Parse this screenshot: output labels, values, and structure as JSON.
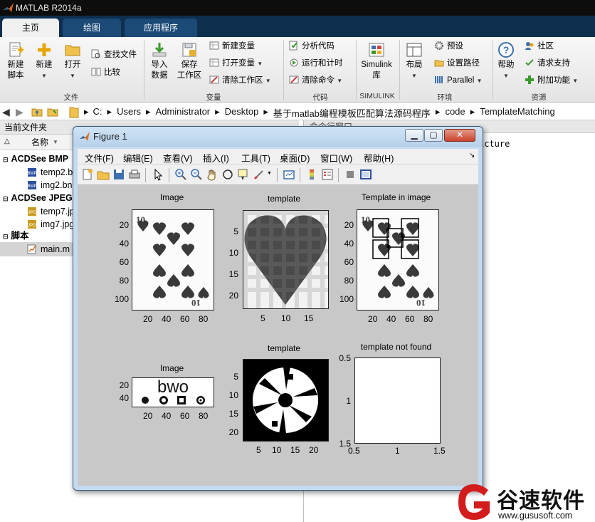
{
  "window": {
    "title": "MATLAB R2014a"
  },
  "tabs": [
    {
      "label": "主页"
    },
    {
      "label": "绘图"
    },
    {
      "label": "应用程序"
    }
  ],
  "ribbon": {
    "new_script": "新建\n脚本",
    "new_script_l1": "新建",
    "new_script_l2": "脚本",
    "new": "新建",
    "open": "打开",
    "find_files": "查找文件",
    "compare": "比较",
    "import_l1": "导入",
    "import_l2": "数据",
    "save_l1": "保存",
    "save_l2": "工作区",
    "new_var": "新建变量",
    "open_var": "打开变量",
    "clear_ws": "清除工作区",
    "analyze": "分析代码",
    "run_time": "运行和计时",
    "clear_cmd": "清除命令",
    "simulink_l1": "Simulink",
    "simulink_l2": "库",
    "layout": "布局",
    "prefs": "预设",
    "set_path": "设置路径",
    "parallel": "Parallel",
    "help": "帮助",
    "community": "社区",
    "support": "请求支持",
    "addons": "附加功能",
    "sections": {
      "file": "文件",
      "variable": "变量",
      "code": "代码",
      "simulink": "SIMULINK",
      "env": "环境",
      "resources": "资源"
    }
  },
  "address": {
    "crumbs": [
      "C:",
      "Users",
      "Administrator",
      "Desktop",
      "基于matlab编程模板匹配算法源码程序",
      "code",
      "TemplateMatching"
    ]
  },
  "current_folder": {
    "title": "当前文件夹",
    "col_name": "名称",
    "groups": [
      {
        "label": "ACDSee BMP",
        "files": [
          "temp2.b",
          "img2.bn"
        ]
      },
      {
        "label": "ACDSee JPEG",
        "files": [
          "temp7.jp",
          "img7.jpg"
        ]
      },
      {
        "label": "脚本",
        "files": [
          "main.m"
        ]
      }
    ]
  },
  "command_window": {
    "title": "命令行窗口",
    "text": "icture"
  },
  "figure": {
    "title": "Figure 1",
    "menus": [
      "文件(F)",
      "编辑(E)",
      "查看(V)",
      "插入(I)",
      "工具(T)",
      "桌面(D)",
      "窗口(W)",
      "帮助(H)"
    ],
    "axes": [
      {
        "title": "Image",
        "xticks": [
          "20",
          "40",
          "60",
          "80"
        ],
        "yticks": [
          "20",
          "40",
          "60",
          "80",
          "100"
        ]
      },
      {
        "title": "template",
        "xticks": [
          "5",
          "10",
          "15"
        ],
        "yticks": [
          "5",
          "10",
          "15",
          "20"
        ]
      },
      {
        "title": "Template in image",
        "xticks": [
          "20",
          "40",
          "60",
          "80"
        ],
        "yticks": [
          "20",
          "40",
          "60",
          "80",
          "100"
        ]
      },
      {
        "title": "Image",
        "xticks": [
          "20",
          "40",
          "60",
          "80"
        ],
        "yticks": [
          "20",
          "40"
        ],
        "text": "bwo"
      },
      {
        "title": "template",
        "xticks": [
          "5",
          "10",
          "15",
          "20"
        ],
        "yticks": [
          "5",
          "10",
          "15",
          "20"
        ]
      },
      {
        "title": "template not found",
        "xticks": [
          "0.5",
          "1",
          "1.5"
        ],
        "yticks": [
          "0.5",
          "1",
          "1.5"
        ]
      }
    ]
  },
  "watermark": {
    "brand": "谷速软件",
    "url": "www.gususoft.com"
  }
}
